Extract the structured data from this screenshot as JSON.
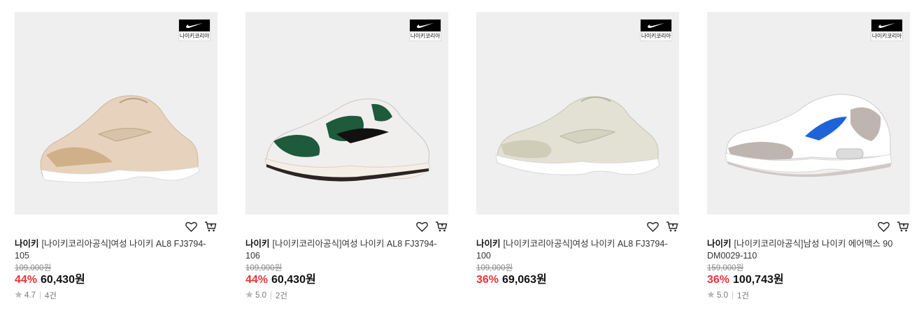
{
  "products": [
    {
      "brand": "나이키",
      "name": "[나이키코리아공식]여성 나이키 AL8 FJ3794-105",
      "original_price": "109,000원",
      "discount": "44%",
      "price": "60,430원",
      "rating": "4.7",
      "reviews": "4건",
      "badge_text": "나이키코리아",
      "colors": {
        "upper": "#e7d2bd",
        "accent": "#caa87a",
        "sole": "#ffffff",
        "swoosh": "#d8c2a8"
      }
    },
    {
      "brand": "나이키",
      "name": "[나이키코리아공식]여성 나이키 AL8 FJ3794-106",
      "original_price": "109,000원",
      "discount": "44%",
      "price": "60,430원",
      "rating": "5.0",
      "reviews": "2건",
      "badge_text": "나이키코리아",
      "colors": {
        "upper": "#f1eeee",
        "accent": "#1e5a3c",
        "sole": "#f3efe6",
        "swoosh": "#111111"
      }
    },
    {
      "brand": "나이키",
      "name": "[나이키코리아공식]여성 나이키 AL8 FJ3794-100",
      "original_price": "109,000원",
      "discount": "36%",
      "price": "69,063원",
      "rating": "",
      "reviews": "",
      "badge_text": "나이키코리아",
      "colors": {
        "upper": "#e2e1d4",
        "accent": "#cfcdb8",
        "sole": "#ffffff",
        "swoosh": "#d4d2c0"
      }
    },
    {
      "brand": "나이키",
      "name": "[나이키코리아공식]남성 나이키 에어맥스 90 DM0029-110",
      "original_price": "159,000원",
      "discount": "36%",
      "price": "100,743원",
      "rating": "5.0",
      "reviews": "1건",
      "badge_text": "나이키코리아",
      "colors": {
        "upper": "#ffffff",
        "accent": "#bfb5b0",
        "sole": "#ffffff",
        "swoosh": "#1f63d8"
      }
    }
  ],
  "icons": {
    "wishlist": "heart-icon",
    "cart": "cart-icon",
    "rating": "star-icon"
  }
}
